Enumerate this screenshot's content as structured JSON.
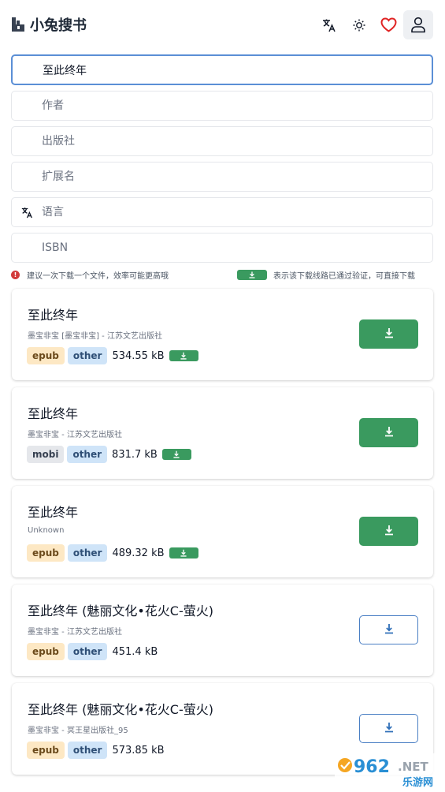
{
  "header": {
    "title": "小兔搜书",
    "icons": [
      "logo-icon",
      "translate-icon",
      "theme-sun-icon",
      "heart-icon",
      "user-icon"
    ],
    "heart_color": "#e02424"
  },
  "search": {
    "title_value": "至此终年",
    "author_placeholder": "作者",
    "publisher_placeholder": "出版社",
    "extension_placeholder": "扩展名",
    "language_placeholder": "语言",
    "isbn_placeholder": "ISBN"
  },
  "hints": {
    "left": "建议一次下载一个文件，效率可能更高哦",
    "right": "表示该下载线路已通过验证，可直接下载"
  },
  "colors": {
    "accent_green": "#3a9a5f",
    "focus_blue": "#5b8fd6"
  },
  "results": [
    {
      "title": "至此终年",
      "meta": "墨宝非宝 [墨宝非宝] - 江苏文艺出版社",
      "format": "epub",
      "category": "other",
      "size": "534.55 kB",
      "verified": true,
      "button": "solid"
    },
    {
      "title": "至此终年",
      "meta": "墨宝非宝 - 江苏文艺出版社",
      "format": "mobi",
      "category": "other",
      "size": "831.7 kB",
      "verified": true,
      "button": "solid"
    },
    {
      "title": "至此终年",
      "meta": "Unknown",
      "format": "epub",
      "category": "other",
      "size": "489.32 kB",
      "verified": true,
      "button": "solid"
    },
    {
      "title": "至此终年 (魅丽文化•花火C-萤火)",
      "meta": "墨宝非宝 - 江苏文艺出版社",
      "format": "epub",
      "category": "other",
      "size": "451.4 kB",
      "verified": false,
      "button": "outline"
    },
    {
      "title": "至此终年 (魅丽文化•花火C-萤火)",
      "meta": "墨宝非宝 - 冥王星出版社_95",
      "format": "epub",
      "category": "other",
      "size": "573.85 kB",
      "verified": false,
      "button": "outline"
    }
  ],
  "watermark": {
    "brand": "962",
    "suffix": ".NET",
    "site": "乐游网"
  }
}
